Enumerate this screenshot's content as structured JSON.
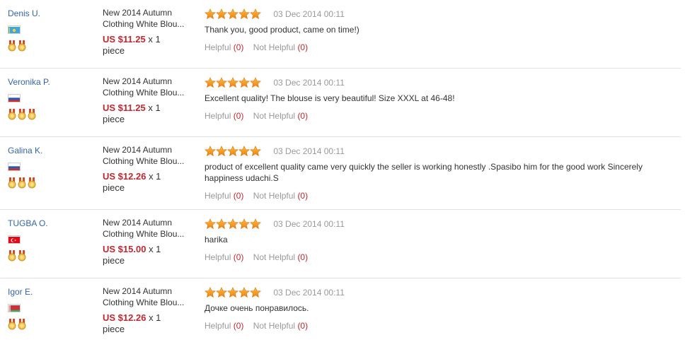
{
  "colors": {
    "name": "#3366aa",
    "price": "#c0272d",
    "muted": "#999999",
    "star": "#f7941d"
  },
  "icons": {
    "star": "star-icon",
    "medal": "medal-icon",
    "flag": "flag-icon"
  },
  "reviews": [
    {
      "buyer": "Denis U.",
      "country": "KZ",
      "medals": 2,
      "product": "New 2014 Autumn Clothing White Blou...",
      "product_line1": "New 2014 Autumn",
      "product_line2": "Clothing White Blou...",
      "price": "US $11.25",
      "qty": "x 1",
      "unit": "piece",
      "rating": 5,
      "date": "03 Dec 2014 00:11",
      "text": "Thank you, good product, came on time!)",
      "helpful_label": "Helpful",
      "helpful": "(0)",
      "not_helpful_label": "Not Helpful",
      "not_helpful": "(0)"
    },
    {
      "buyer": "Veronika P.",
      "country": "RU",
      "medals": 3,
      "product_line1": "New 2014 Autumn",
      "product_line2": "Clothing White Blou...",
      "price": "US $11.25",
      "qty": "x 1",
      "unit": "piece",
      "rating": 5,
      "date": "03 Dec 2014 00:11",
      "text": "Excellent quality! The blouse is very beautiful! Size XXXL at 46-48!",
      "helpful_label": "Helpful",
      "helpful": "(0)",
      "not_helpful_label": "Not Helpful",
      "not_helpful": "(0)"
    },
    {
      "buyer": "Galina K.",
      "country": "RU",
      "medals": 3,
      "product_line1": "New 2014 Autumn",
      "product_line2": "Clothing White Blou...",
      "price": "US $12.26",
      "qty": "x 1",
      "unit": "piece",
      "rating": 5,
      "date": "03 Dec 2014 00:11",
      "text": "product of excellent quality came very quickly the seller is working honestly .Spasibo him for the good work Sincerely happiness udachi.S",
      "helpful_label": "Helpful",
      "helpful": "(0)",
      "not_helpful_label": "Not Helpful",
      "not_helpful": "(0)"
    },
    {
      "buyer": "TUGBA O.",
      "country": "TR",
      "medals": 2,
      "product_line1": "New 2014 Autumn",
      "product_line2": "Clothing White Blou...",
      "price": "US $15.00",
      "qty": "x 1",
      "unit": "piece",
      "rating": 5,
      "date": "03 Dec 2014 00:11",
      "text": "harika",
      "helpful_label": "Helpful",
      "helpful": "(0)",
      "not_helpful_label": "Not Helpful",
      "not_helpful": "(0)"
    },
    {
      "buyer": "Igor E.",
      "country": "BY",
      "medals": 2,
      "product_line1": "New 2014 Autumn",
      "product_line2": "Clothing White Blou...",
      "price": "US $12.26",
      "qty": "x 1",
      "unit": "piece",
      "rating": 5,
      "date": "03 Dec 2014 00:11",
      "text": "Дочке очень понравилось.",
      "helpful_label": "Helpful",
      "helpful": "(0)",
      "not_helpful_label": "Not Helpful",
      "not_helpful": "(0)"
    }
  ]
}
